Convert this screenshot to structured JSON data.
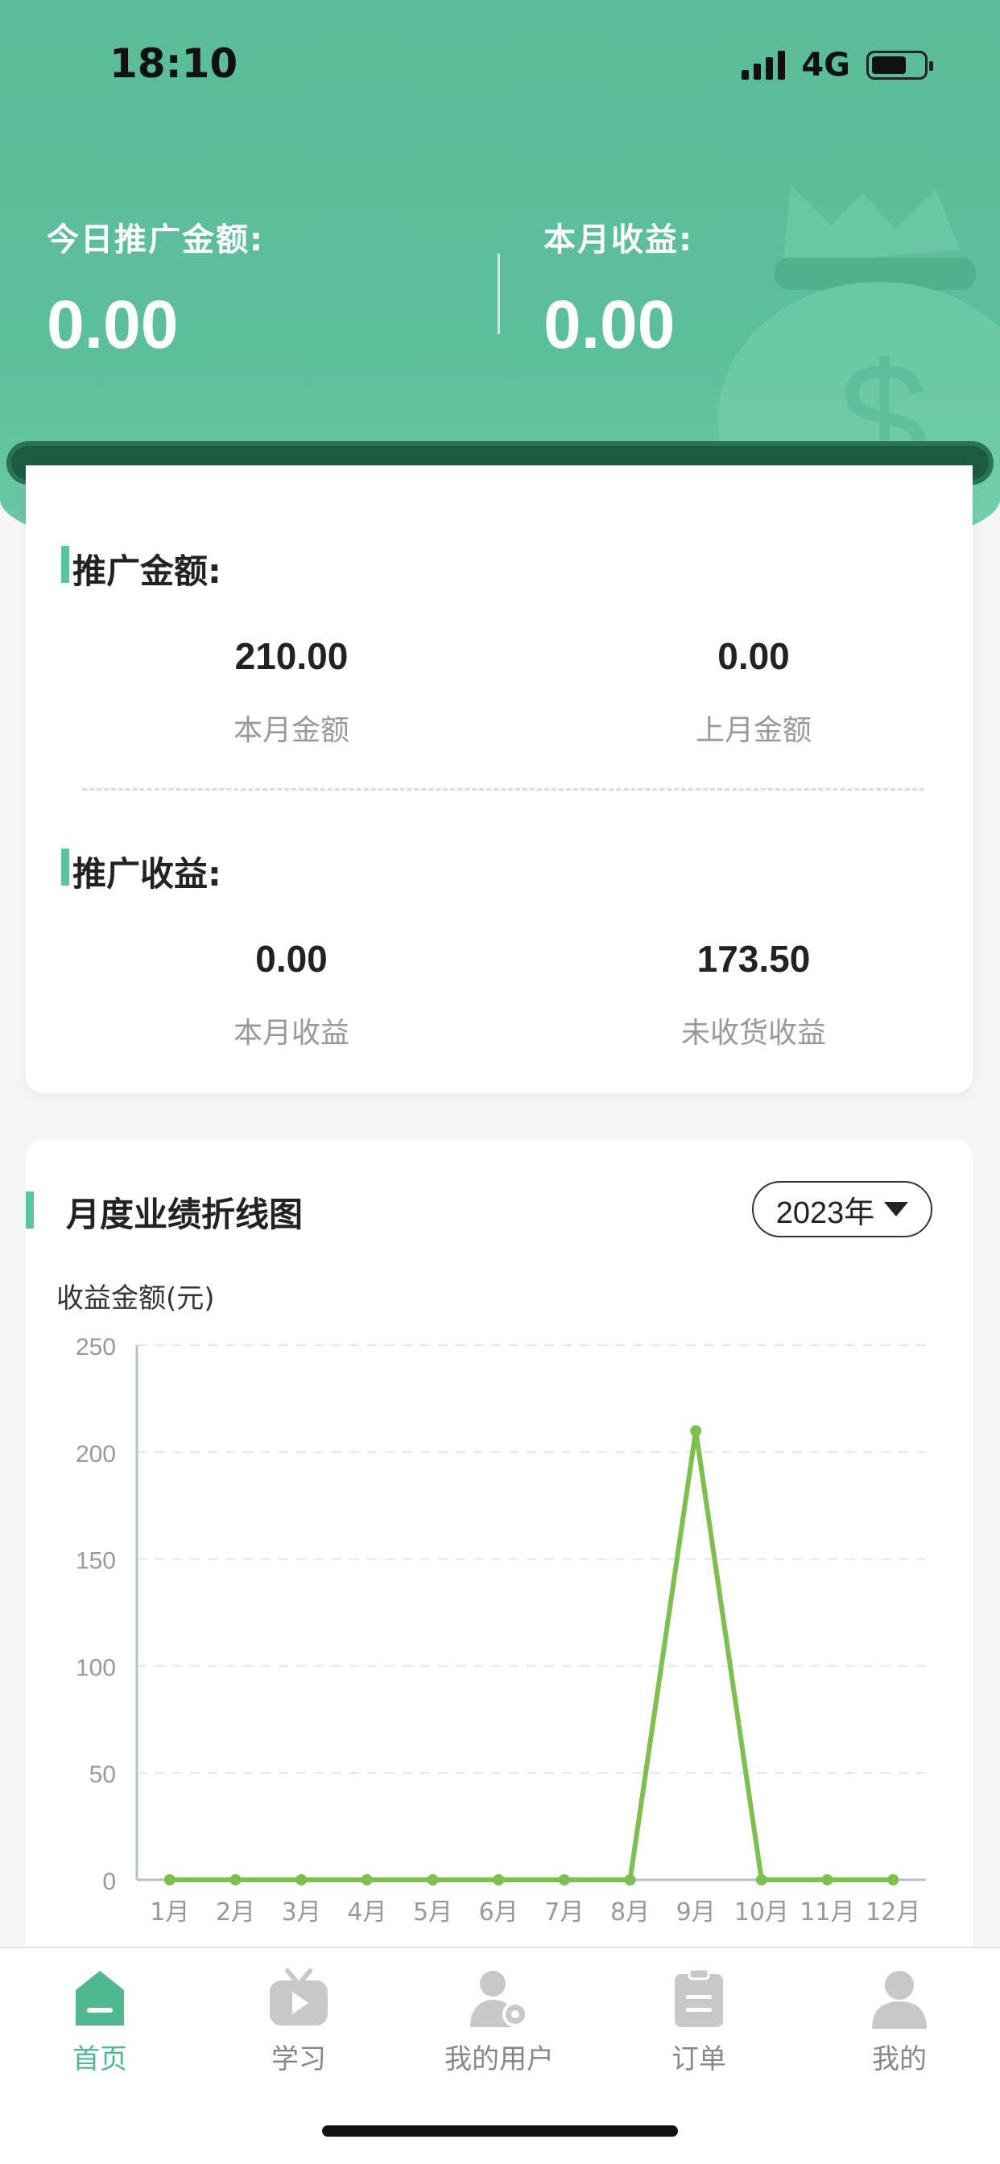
{
  "status": {
    "time": "18:10",
    "network": "4G"
  },
  "header": {
    "today_label": "今日推广金额:",
    "today_value": "0.00",
    "month_label": "本月收益:",
    "month_value": "0.00"
  },
  "promo_amount": {
    "title": "推广金额:",
    "items": [
      {
        "value": "210.00",
        "label": "本月金额"
      },
      {
        "value": "0.00",
        "label": "上月金额"
      }
    ]
  },
  "promo_income": {
    "title": "推广收益:",
    "items": [
      {
        "value": "0.00",
        "label": "本月收益"
      },
      {
        "value": "173.50",
        "label": "未收货收益"
      }
    ]
  },
  "chart_card": {
    "title": "月度业绩折线图",
    "year": "2023年",
    "y_axis_label": "收益金额(元)"
  },
  "chart_data": {
    "type": "line",
    "categories": [
      "1月",
      "2月",
      "3月",
      "4月",
      "5月",
      "6月",
      "7月",
      "8月",
      "9月",
      "10月",
      "11月",
      "12月"
    ],
    "series": [
      {
        "values": [
          0,
          0,
          0,
          0,
          0,
          0,
          0,
          0,
          210,
          0,
          0,
          0
        ]
      }
    ],
    "ylabel": "收益金额(元)",
    "ylim": [
      0,
      250
    ],
    "yticks": [
      0,
      50,
      100,
      150,
      200,
      250
    ],
    "grid": true,
    "line_color": "#7cc04e"
  },
  "tabbar": {
    "items": [
      {
        "label": "首页",
        "icon": "home-icon",
        "active": true
      },
      {
        "label": "学习",
        "icon": "tv-play-icon",
        "active": false
      },
      {
        "label": "我的用户",
        "icon": "user-settings-icon",
        "active": false
      },
      {
        "label": "订单",
        "icon": "clipboard-icon",
        "active": false
      },
      {
        "label": "我的",
        "icon": "profile-icon",
        "active": false
      }
    ]
  },
  "colors": {
    "brand": "#5bbb9a",
    "accent": "#59c49d",
    "tab_active": "#4fb891"
  }
}
